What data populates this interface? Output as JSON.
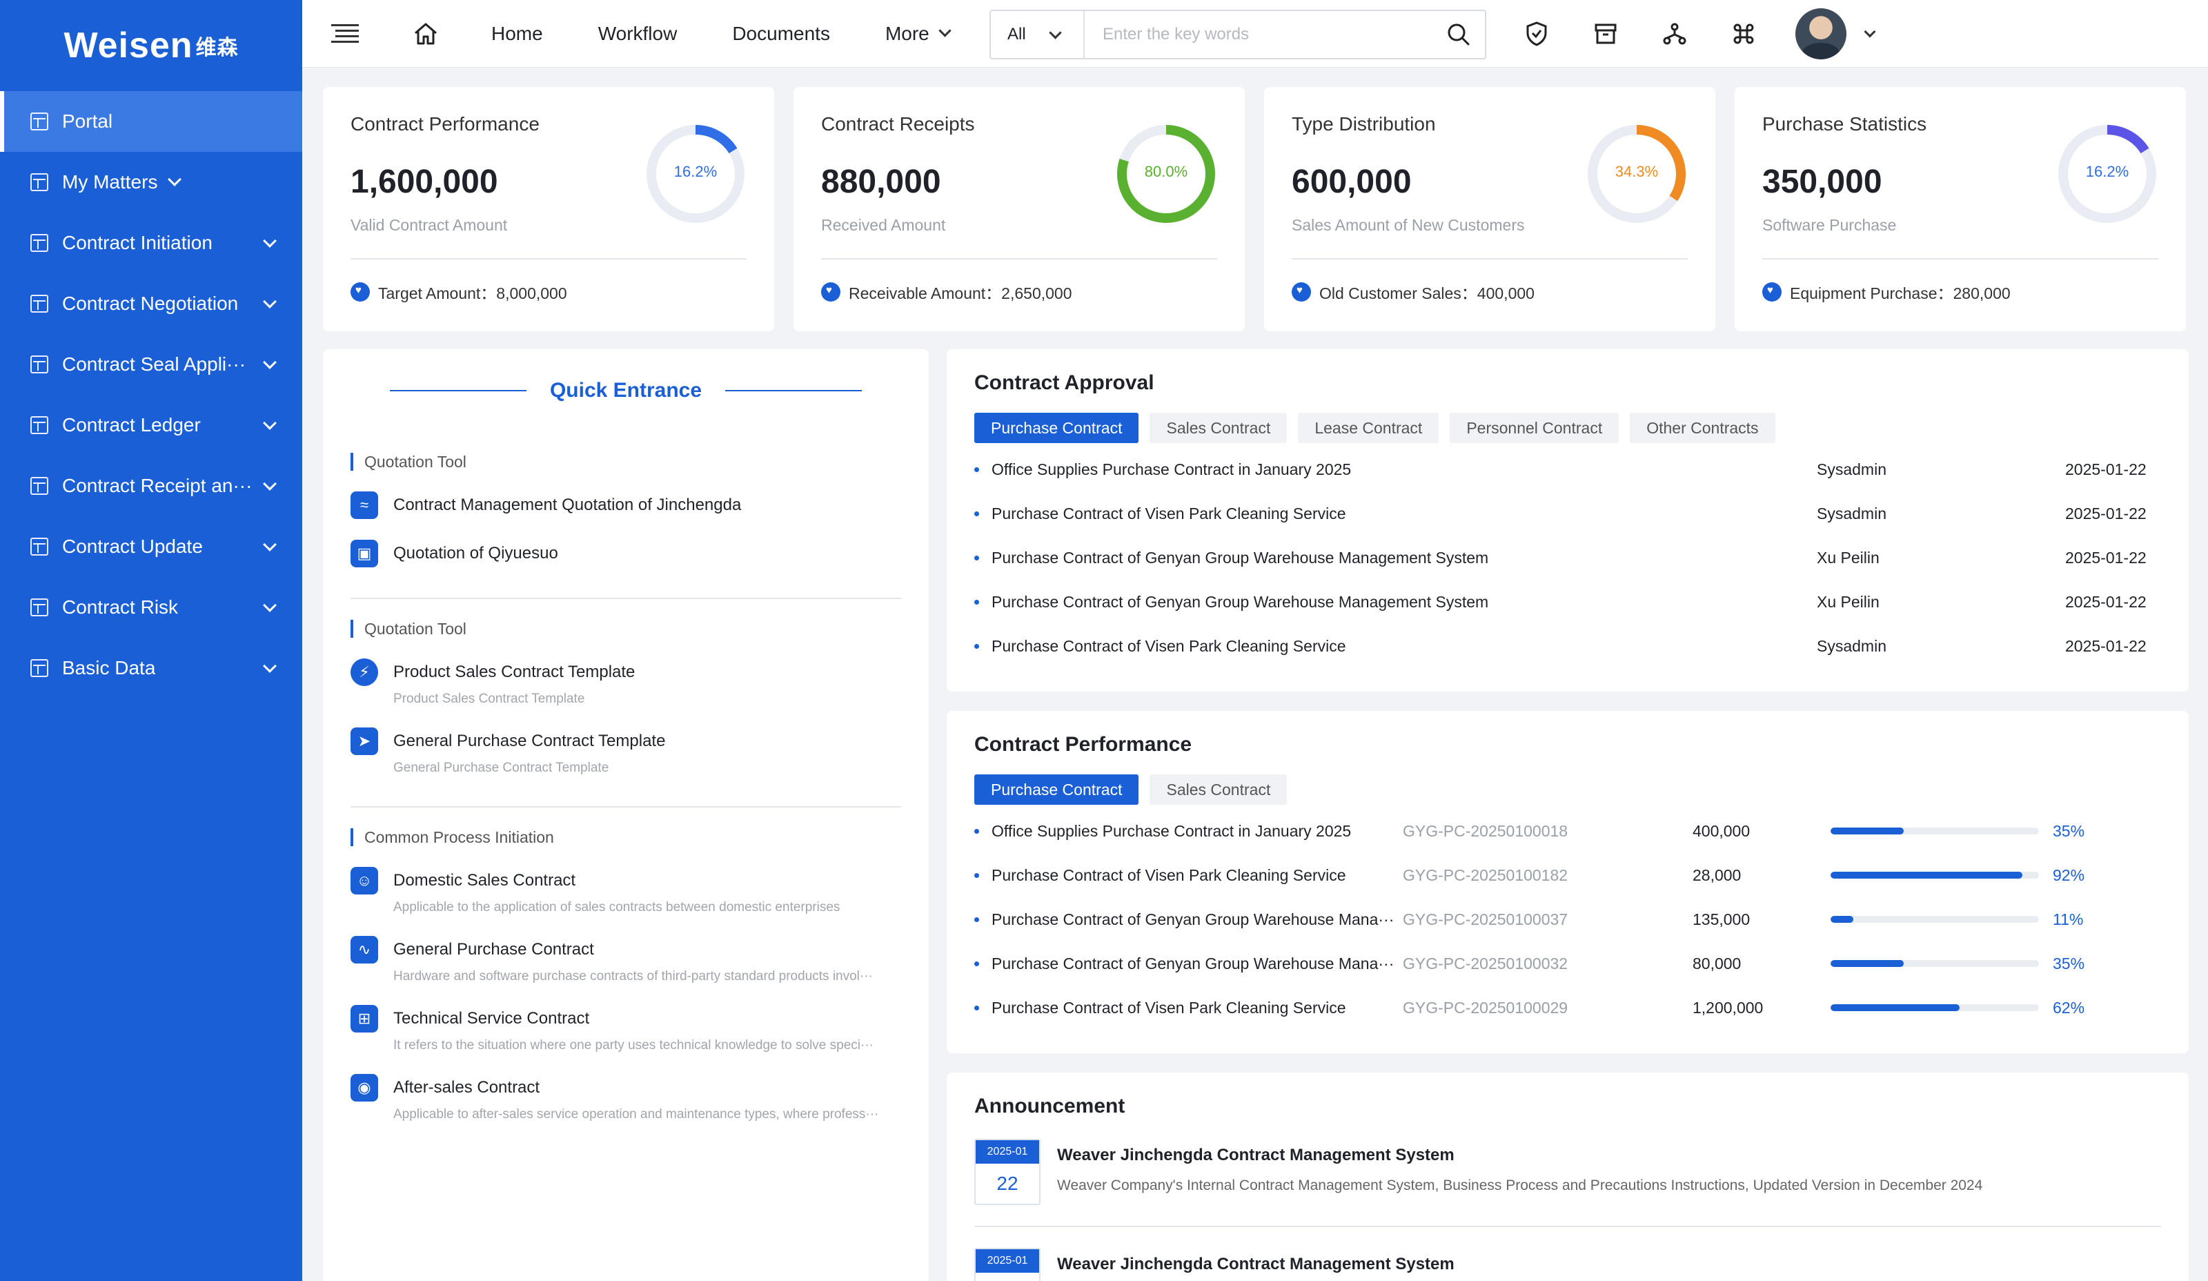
{
  "app": {
    "logo_text": "Weisen",
    "logo_cn": "维森"
  },
  "sidebar": {
    "items": [
      {
        "label": "Portal",
        "active": true,
        "chevron": false
      },
      {
        "label": "My Matters",
        "chevron": "inline"
      },
      {
        "label": "Contract Initiation",
        "chevron": true
      },
      {
        "label": "Contract Negotiation",
        "chevron": true
      },
      {
        "label": "Contract Seal Appli···",
        "chevron": true
      },
      {
        "label": "Contract Ledger",
        "chevron": true
      },
      {
        "label": "Contract Receipt an···",
        "chevron": true
      },
      {
        "label": "Contract Update",
        "chevron": true
      },
      {
        "label": "Contract Risk",
        "chevron": true
      },
      {
        "label": "Basic Data",
        "chevron": true
      }
    ]
  },
  "header": {
    "nav": [
      "Home",
      "Workflow",
      "Documents",
      "More"
    ],
    "search": {
      "scope": "All",
      "placeholder": "Enter the key words"
    },
    "icons": [
      "shield-icon",
      "archive-icon",
      "org-chart-icon",
      "command-icon"
    ]
  },
  "stats": [
    {
      "title": "Contract  Performance",
      "value": "1,600,000",
      "sub": "Valid Contract Amount",
      "foot": "Target Amount：8,000,000",
      "percent_label": "16.2%",
      "percent": 16.2,
      "color": "#2f6ee6",
      "label_color": "#2f6ee6"
    },
    {
      "title": "Contract Receipts",
      "value": "880,000",
      "sub": "Received Amount",
      "foot": "Receivable Amount：2,650,000",
      "percent_label": "80.0%",
      "percent": 80.0,
      "color": "#5ab02f",
      "label_color": "#5ab02f"
    },
    {
      "title": "Type Distribution",
      "value": "600,000",
      "sub": "Sales Amount of New Customers",
      "foot": "Old Customer Sales：400,000",
      "percent_label": "34.3%",
      "percent": 34.3,
      "color": "#f08a22",
      "label_color": "#f08a22"
    },
    {
      "title": "Purchase Statistics",
      "value": "350,000",
      "sub": "Software Purchase",
      "foot": "Equipment Purchase：280,000",
      "percent_label": "16.2%",
      "percent": 16.2,
      "color": "#5b54e6",
      "label_color": "#2f6ee6"
    }
  ],
  "quick": {
    "title": "Quick Entrance",
    "sections": [
      {
        "title": "Quotation Tool",
        "items": [
          {
            "title": "Contract Management Quotation of Jinchengda",
            "desc": "",
            "icon": "pulse-badge-icon",
            "glyph": "≈"
          },
          {
            "title": "Quotation of Qiyuesuo",
            "desc": "",
            "icon": "lock-shield-icon",
            "glyph": "▣"
          }
        ]
      },
      {
        "title": "Quotation Tool",
        "items": [
          {
            "title": "Product Sales Contract Template",
            "desc": "Product Sales Contract Template",
            "icon": "lightning-search-icon",
            "glyph": "⚡"
          },
          {
            "title": "General Purchase Contract Template",
            "desc": "General Purchase Contract Template",
            "icon": "rocket-icon",
            "glyph": "➤"
          }
        ]
      },
      {
        "title": "Common Process Initiation",
        "items": [
          {
            "title": "Domestic Sales Contract",
            "desc": "Applicable to the application of sales contracts between domestic enterprises",
            "icon": "person-folder-icon",
            "glyph": "☺"
          },
          {
            "title": "General Purchase Contract",
            "desc": "Hardware and software purchase contracts of third-party standard products invol···",
            "icon": "heartbeat-icon",
            "glyph": "∿"
          },
          {
            "title": "Technical Service Contract",
            "desc": "It refers to the situation where one party uses technical knowledge to solve speci···",
            "icon": "grid-document-icon",
            "glyph": "⊞"
          },
          {
            "title": "After-sales Contract",
            "desc": "Applicable to after-sales service operation and maintenance types, where profess···",
            "icon": "record-document-icon",
            "glyph": "◉"
          }
        ]
      }
    ]
  },
  "approval": {
    "title": "Contract Approval",
    "tabs": [
      "Purchase Contract",
      "Sales Contract",
      "Lease Contract",
      "Personnel Contract",
      "Other Contracts"
    ],
    "rows": [
      {
        "name": "Office Supplies Purchase Contract in January 2025",
        "user": "Sysadmin",
        "date": "2025-01-22"
      },
      {
        "name": "Purchase Contract of Visen Park Cleaning Service",
        "user": "Sysadmin",
        "date": "2025-01-22"
      },
      {
        "name": "Purchase Contract of Genyan Group Warehouse Management System",
        "user": "Xu Peilin",
        "date": "2025-01-22"
      },
      {
        "name": "Purchase Contract of Genyan Group Warehouse Management System",
        "user": "Xu Peilin",
        "date": "2025-01-22"
      },
      {
        "name": "Purchase Contract of Visen Park Cleaning Service",
        "user": "Sysadmin",
        "date": "2025-01-22"
      }
    ]
  },
  "performance": {
    "title": "Contract Performance",
    "tabs": [
      "Purchase Contract",
      "Sales Contract"
    ],
    "rows": [
      {
        "name": "Office Supplies Purchase Contract in January 2025",
        "code": "GYG-PC-20250100018",
        "amount": "400,000",
        "percent": 35,
        "percent_label": "35%"
      },
      {
        "name": "Purchase Contract of Visen Park Cleaning Service",
        "code": "GYG-PC-20250100182",
        "amount": "28,000",
        "percent": 92,
        "percent_label": "92%"
      },
      {
        "name": "Purchase Contract of Genyan Group Warehouse Mana···",
        "code": "GYG-PC-20250100037",
        "amount": "135,000",
        "percent": 11,
        "percent_label": "11%"
      },
      {
        "name": "Purchase Contract of Genyan Group Warehouse Mana···",
        "code": "GYG-PC-20250100032",
        "amount": "80,000",
        "percent": 35,
        "percent_label": "35%"
      },
      {
        "name": "Purchase Contract of Visen Park Cleaning Service",
        "code": "GYG-PC-20250100029",
        "amount": "1,200,000",
        "percent": 62,
        "percent_label": "62%"
      }
    ]
  },
  "announcement": {
    "title": "Announcement",
    "items": [
      {
        "ym": "2025-01",
        "day": "22",
        "title": "Weaver Jinchengda Contract Management System",
        "desc": "Weaver Company's Internal Contract Management System, Business Process and Precautions Instructions, Updated Version in December 2024"
      },
      {
        "ym": "2025-01",
        "day": "",
        "title": "Weaver Jinchengda Contract Management System",
        "desc": ""
      }
    ]
  }
}
